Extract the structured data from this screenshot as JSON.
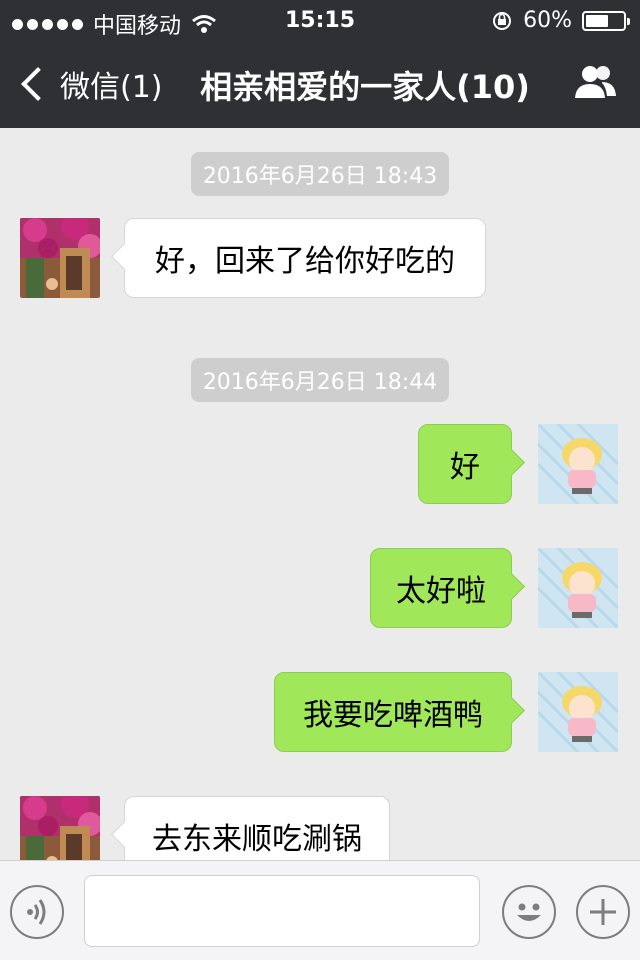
{
  "status_bar": {
    "carrier": "中国移动",
    "time": "15:15",
    "battery": "60%",
    "battery_level": 0.6
  },
  "nav": {
    "back_label": "微信(1)",
    "title": "相亲相爱的一家人(10)",
    "icons": {
      "back": "chevron-left-icon",
      "members": "people-icon"
    }
  },
  "messages": [
    {
      "type": "timestamp",
      "text": "2016年6月26日 18:43"
    },
    {
      "type": "incoming",
      "text": "好，回来了给你好吃的",
      "avatar": "flower-house-avatar"
    },
    {
      "type": "timestamp",
      "text": "2016年6月26日 18:44"
    },
    {
      "type": "outgoing",
      "text": "好",
      "avatar": "cartoon-girl-avatar"
    },
    {
      "type": "outgoing",
      "text": "太好啦",
      "avatar": "cartoon-girl-avatar"
    },
    {
      "type": "outgoing",
      "text": "我要吃啤酒鸭",
      "avatar": "cartoon-girl-avatar"
    },
    {
      "type": "incoming",
      "text": "去东来顺吃涮锅",
      "avatar": "flower-house-avatar"
    }
  ],
  "input_bar": {
    "icons": {
      "voice": "voice-icon",
      "emoji": "emoji-icon",
      "more": "plus-icon"
    }
  },
  "colors": {
    "nav_bg": "#2f3034",
    "chat_bg": "#ebebeb",
    "outgoing_bubble": "#a0e75a",
    "incoming_bubble": "#ffffff"
  }
}
